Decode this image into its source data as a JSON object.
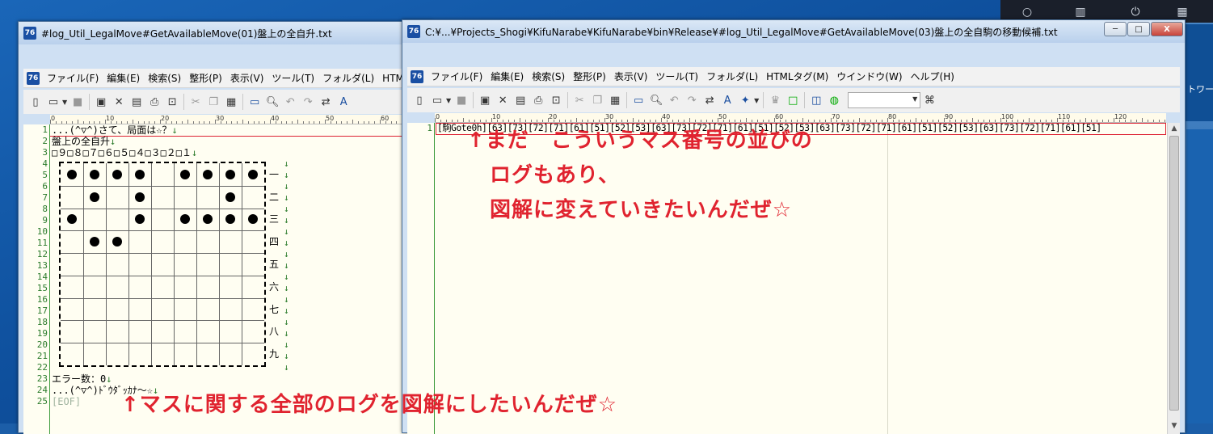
{
  "desktop": {
    "tray_label": "トワー"
  },
  "left_window": {
    "title": "#log_Util_LegalMove#GetAvailableMove(01)盤上の全自升.txt",
    "menu": [
      "ファイル(F)",
      "編集(E)",
      "検索(S)",
      "整形(P)",
      "表示(V)",
      "ツール(T)",
      "フォルダ(L)",
      "HTM"
    ],
    "ruler_labels": [
      "0",
      "10",
      "20",
      "30",
      "40",
      "50",
      "60"
    ],
    "lines": [
      "...(^▽^)さて、局面は☆？",
      "盤上の全自升",
      "□９□８□７□６□５□４□３□２□１",
      "",
      "",
      "",
      "",
      "",
      "",
      "",
      "",
      "",
      "",
      "",
      "",
      "",
      "",
      "",
      "",
      "",
      "",
      "",
      "エラー数：0",
      "...(^▽^)ﾄﾞｳﾀﾞｯｶﾅ～☆",
      "[EOF]"
    ],
    "line_numbers": [
      "1",
      "2",
      "3",
      "4",
      "5",
      "6",
      "7",
      "8",
      "9",
      "10",
      "11",
      "12",
      "13",
      "14",
      "15",
      "16",
      "17",
      "18",
      "19",
      "20",
      "21",
      "22",
      "23",
      "24",
      "25"
    ],
    "rank_labels": [
      "一",
      "二",
      "三",
      "四",
      "五",
      "六",
      "七",
      "八",
      "九"
    ],
    "eol_mark": "↓",
    "board_stones": [
      {
        "row": 0,
        "col": 0
      },
      {
        "row": 0,
        "col": 1
      },
      {
        "row": 0,
        "col": 2
      },
      {
        "row": 0,
        "col": 3
      },
      {
        "row": 0,
        "col": 5
      },
      {
        "row": 0,
        "col": 6
      },
      {
        "row": 0,
        "col": 7
      },
      {
        "row": 0,
        "col": 8
      },
      {
        "row": 1,
        "col": 1
      },
      {
        "row": 1,
        "col": 3
      },
      {
        "row": 1,
        "col": 7
      },
      {
        "row": 2,
        "col": 0
      },
      {
        "row": 2,
        "col": 3
      },
      {
        "row": 2,
        "col": 5
      },
      {
        "row": 2,
        "col": 6
      },
      {
        "row": 2,
        "col": 7
      },
      {
        "row": 2,
        "col": 8
      },
      {
        "row": 3,
        "col": 1
      },
      {
        "row": 3,
        "col": 2
      }
    ]
  },
  "right_window": {
    "title": "C:¥...¥Projects_Shogi¥KifuNarabe¥KifuNarabe¥bin¥Release¥#log_Util_LegalMove#GetAvailableMove(03)盤上の全自駒の移動候補.txt",
    "menu": [
      "ファイル(F)",
      "編集(E)",
      "検索(S)",
      "整形(P)",
      "表示(V)",
      "ツール(T)",
      "フォルダ(L)",
      "HTMLタグ(M)",
      "ウインドウ(W)",
      "ヘルプ(H)"
    ],
    "ruler_labels": [
      "0",
      "10",
      "20",
      "30",
      "40",
      "50",
      "60",
      "70",
      "80",
      "90",
      "100",
      "110",
      "120"
    ],
    "line1_prefix": "[駒Gote0h]",
    "line1_body": "[63][73][72][71][61][51][52][53][63][73][72][71][61][51][52][53][63][73][72][71][61][51][52][53][63][73][72][71][61][51]",
    "line_number": "1",
    "controls": {
      "minimize": "─",
      "maximize": "□",
      "close": "X"
    }
  },
  "annotations": {
    "right_line1": "↑まだ　こういうマス番号の並びの",
    "right_line2": "ログもあり、",
    "right_line3": "図解に変えていきたいんだぜ☆",
    "bottom": "↑マスに関する全部のログを図解にしたいんだぜ☆"
  },
  "colors": {
    "annotation": "#e0232f",
    "line_number": "#2d7c2d",
    "editor_bg": "#fffef2"
  }
}
